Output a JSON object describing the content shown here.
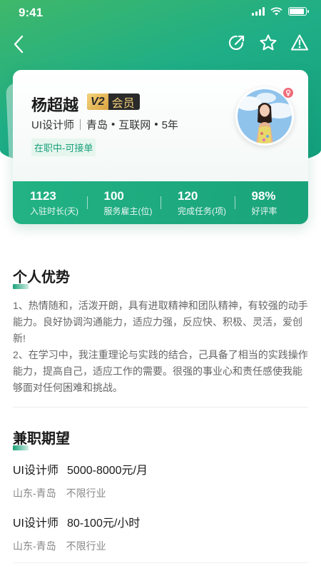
{
  "status_bar": {
    "time": "9:41",
    "battery_level": 0.9
  },
  "nav": {
    "back_icon": "chevron-left-icon",
    "share_icon": "share-icon",
    "favorite_icon": "star-icon",
    "report_icon": "warning-icon"
  },
  "profile": {
    "name": "杨超越",
    "vip_level": "V2",
    "vip_label": "会员",
    "role": "UI设计师",
    "city": "青岛",
    "industry": "互联网",
    "experience": "5年",
    "dot": "•",
    "status": "在职中-可接单",
    "gender_icon": "female-icon"
  },
  "stats": [
    {
      "value": "1123",
      "label": "入驻时长(天)"
    },
    {
      "value": "100",
      "label": "服务雇主(位)"
    },
    {
      "value": "120",
      "label": "完成任务(项)"
    },
    {
      "value": "98%",
      "label": "好评率"
    }
  ],
  "advantage": {
    "title": "个人优势",
    "text": "1、热情随和，活泼开朗，具有进取精神和团队精神，有较强的动手能力。良好协调沟通能力，适应力强，反应快、积极、灵活，爱创新!\n2、在学习中，我注重理论与实践的结合，己具备了相当的实践操作能力，提高自己，适应工作的需要。很强的事业心和责任感使我能够面对任何困难和挑战。"
  },
  "expectation": {
    "title": "兼职期望",
    "jobs": [
      {
        "role": "UI设计师",
        "salary": "5000-8000元/月",
        "location": "山东-青岛",
        "industry": "不限行业"
      },
      {
        "role": "UI设计师",
        "salary": "80-100元/小时",
        "location": "山东-青岛",
        "industry": "不限行业"
      }
    ]
  },
  "colors": {
    "brand": "#1aa37a",
    "brand_light": "#3fb86a",
    "vip_gold": "#f2cf7a",
    "gender_pink": "#f06b7a"
  }
}
